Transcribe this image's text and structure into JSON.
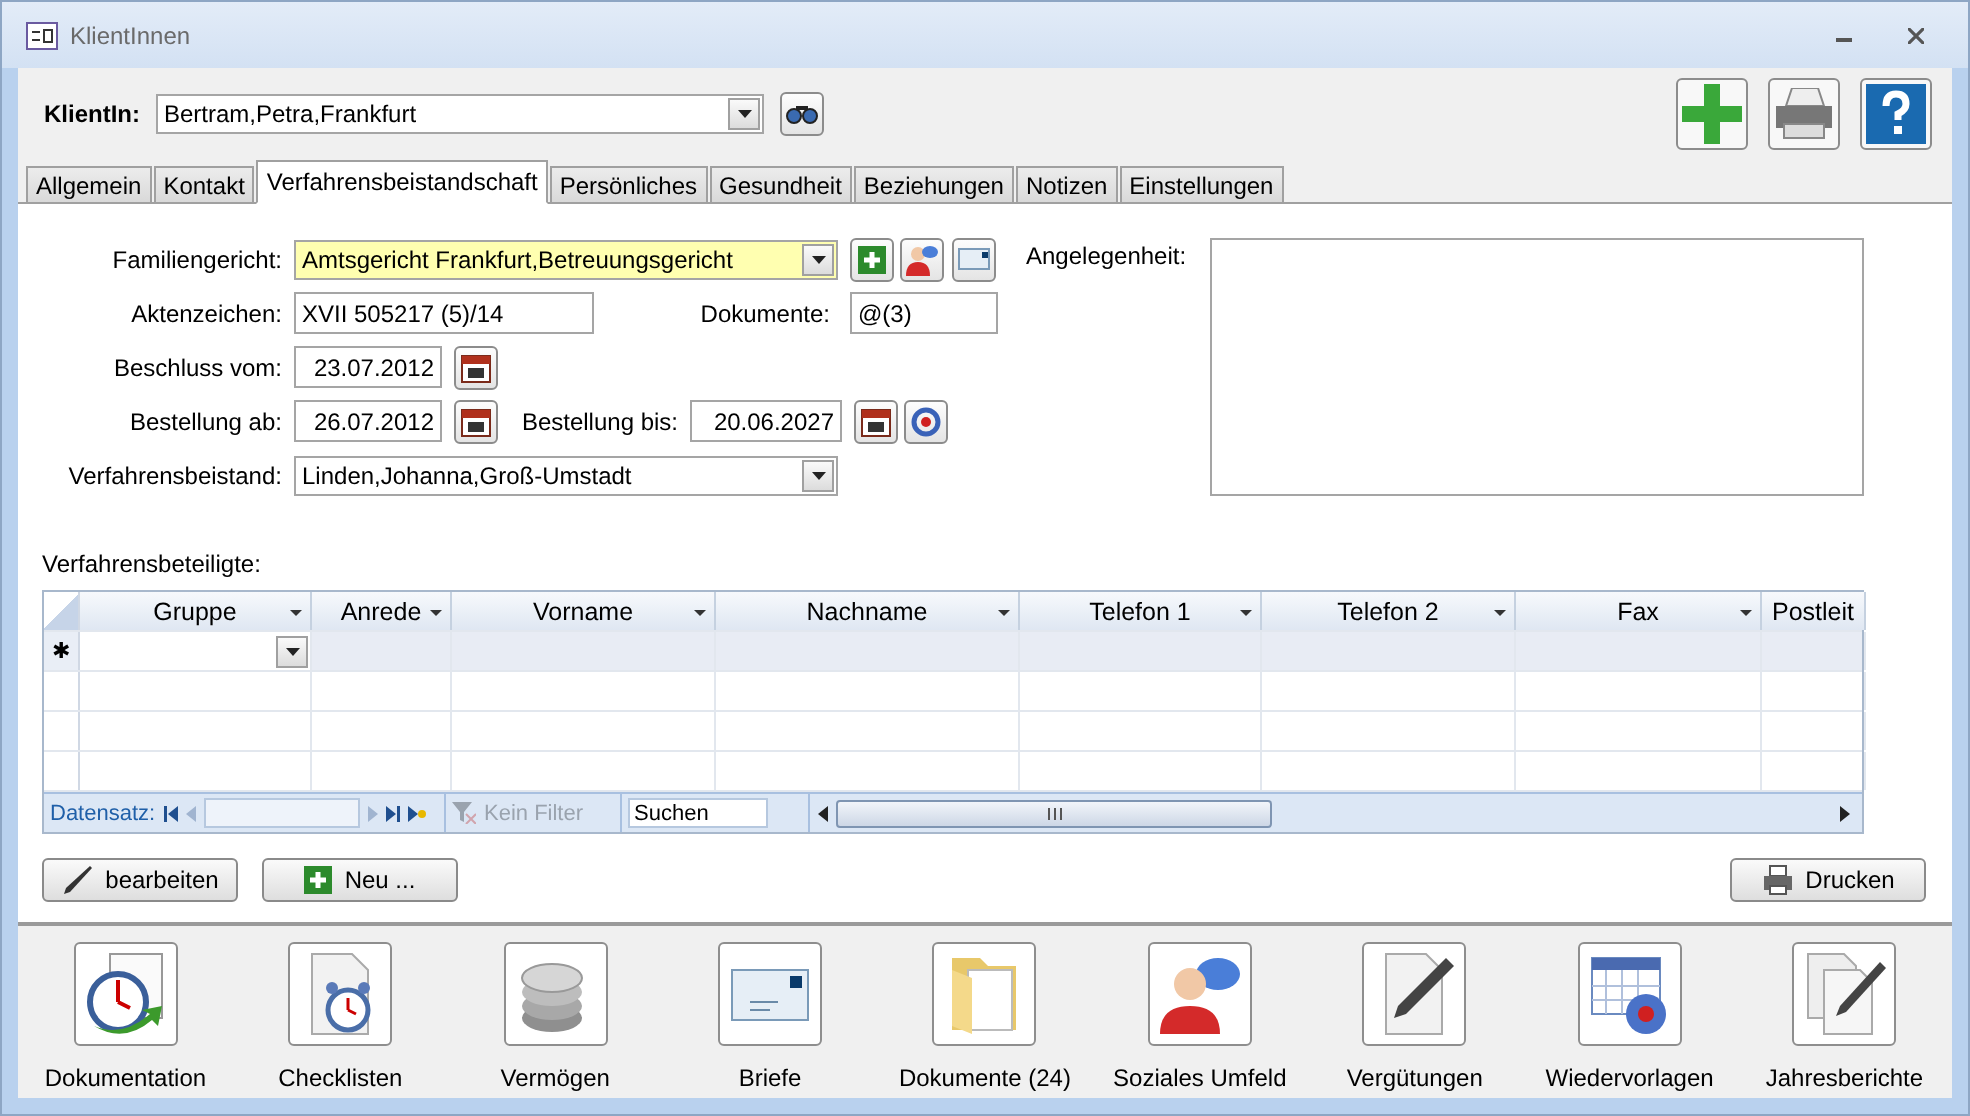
{
  "window": {
    "title": "KlientInnen"
  },
  "client": {
    "label": "KlientIn:",
    "value": "Bertram,Petra,Frankfurt"
  },
  "tabs": [
    {
      "label": "Allgemein",
      "selected": false
    },
    {
      "label": "Kontakt",
      "selected": false
    },
    {
      "label": "Verfahrensbeistandschaft",
      "selected": true
    },
    {
      "label": "Persönliches",
      "selected": false
    },
    {
      "label": "Gesundheit",
      "selected": false
    },
    {
      "label": "Beziehungen",
      "selected": false
    },
    {
      "label": "Notizen",
      "selected": false
    },
    {
      "label": "Einstellungen",
      "selected": false
    }
  ],
  "court": {
    "label": "Familiengericht:",
    "value": "Amtsgericht Frankfurt,Betreuungsgericht"
  },
  "file_number": {
    "label": "Aktenzeichen:",
    "value": "XVII 505217 (5)/14"
  },
  "documents": {
    "label": "Dokumente:",
    "value": "@(3)"
  },
  "decision_date": {
    "label": "Beschluss vom:",
    "value": "23.07.2012"
  },
  "appointed_from": {
    "label": "Bestellung ab:",
    "value": "26.07.2012"
  },
  "appointed_until": {
    "label": "Bestellung bis:",
    "value": "20.06.2027"
  },
  "guardian": {
    "label": "Verfahrensbeistand:",
    "value": "Linden,Johanna,Groß-Umstadt"
  },
  "matter": {
    "label": "Angelegenheit:"
  },
  "participants": {
    "label": "Verfahrensbeteiligte:",
    "new_row_marker": "✱",
    "columns": [
      "Gruppe",
      "Anrede",
      "Vorname",
      "Nachname",
      "Telefon 1",
      "Telefon 2",
      "Fax",
      "Postleit"
    ],
    "record_label": "Datensatz:",
    "filter": {
      "label": "Kein Filter",
      "disabled": true
    },
    "search": "Suchen"
  },
  "actions": [
    {
      "kind": "edit",
      "label": "bearbeiten"
    },
    {
      "kind": "new",
      "label": "Neu ..."
    },
    {
      "kind": "print",
      "label": "Drucken"
    }
  ],
  "shortcuts": [
    {
      "kind": "documentation",
      "label": "Dokumentation"
    },
    {
      "kind": "checklist",
      "label": "Checklisten"
    },
    {
      "kind": "assets",
      "label": "Vermögen"
    },
    {
      "kind": "letters",
      "label": "Briefe"
    },
    {
      "kind": "documents",
      "label": "Dokumente (24)"
    },
    {
      "kind": "social",
      "label": "Soziales Umfeld"
    },
    {
      "kind": "fees",
      "label": "Vergütungen"
    },
    {
      "kind": "reminders",
      "label": "Wiedervorlagen"
    },
    {
      "kind": "reports",
      "label": "Jahresberichte"
    }
  ]
}
